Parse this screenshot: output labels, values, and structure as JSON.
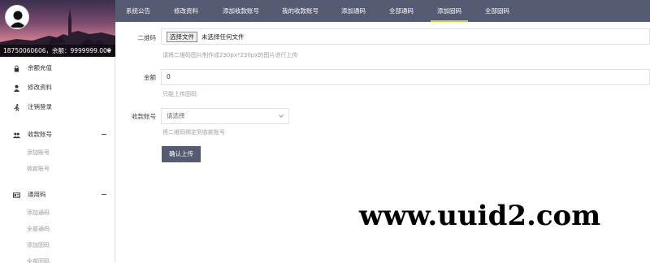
{
  "sidebar": {
    "account": "18750060606，余额：9999999.000",
    "items": [
      {
        "label": "余额充值",
        "icon": "lock-icon"
      },
      {
        "label": "修改资料",
        "icon": "user-icon"
      },
      {
        "label": "注销登录",
        "icon": "running-person-icon"
      }
    ],
    "groups": [
      {
        "label": "收款账号",
        "icon": "users-icon",
        "subitems": [
          "添加账号",
          "收款账号"
        ]
      },
      {
        "label": "通用码",
        "icon": "id-card-icon",
        "subitems": [
          "添加通码",
          "全部通码",
          "添加固码",
          "全部固码"
        ]
      }
    ]
  },
  "topnav": {
    "tabs": [
      "系统公告",
      "修改资料",
      "添加收款账号",
      "我的收款账号",
      "添加通码",
      "全部通码",
      "添加固码",
      "全部固码"
    ],
    "active_index": 6,
    "active_color": "#f2c02f",
    "background": "#545b73"
  },
  "form": {
    "qrcode": {
      "label": "二维码",
      "button": "选择文件",
      "status": "未选择任何文件",
      "hint": "请将二维码图片制作成230px*230px的图片进行上传"
    },
    "amount": {
      "label": "金额",
      "value": "0",
      "hint": "只能上传固码"
    },
    "account": {
      "label": "收款账号",
      "selected": "请选择",
      "hint": "将二维码绑定到收款账号"
    },
    "submit": "确认上传"
  },
  "watermark": "www.uuid2.com"
}
